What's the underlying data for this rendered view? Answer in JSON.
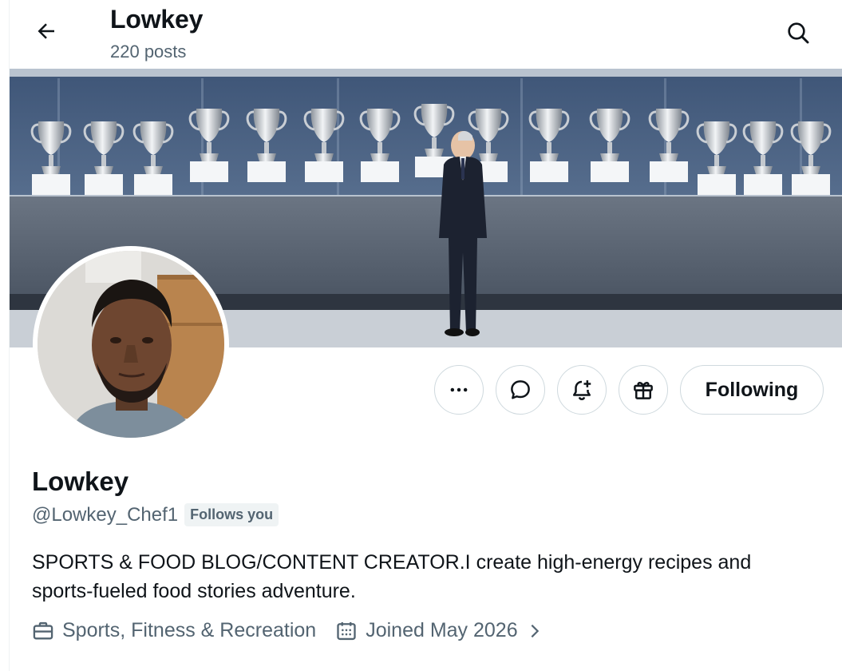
{
  "header": {
    "title": "Lowkey",
    "post_count": "220 posts",
    "back_icon": "arrow-left-icon",
    "search_icon": "search-icon"
  },
  "banner": {
    "description_icon": "banner-image"
  },
  "actions": {
    "more_icon": "more-horizontal-icon",
    "message_icon": "message-icon",
    "notify_icon": "bell-plus-icon",
    "gift_icon": "gift-icon",
    "follow_label": "Following"
  },
  "profile": {
    "display_name": "Lowkey",
    "handle": "@Lowkey_Chef1",
    "follows_you": "Follows you",
    "bio": "SPORTS & FOOD BLOG/CONTENT CREATOR.I create high-energy recipes and sports-fueled food stories adventure.",
    "category": "Sports, Fitness & Recreation",
    "joined": "Joined May 2026"
  },
  "colors": {
    "text_primary": "#0f1419",
    "text_secondary": "#536471",
    "border": "#cfd9de",
    "badge_bg": "#eff3f4"
  }
}
